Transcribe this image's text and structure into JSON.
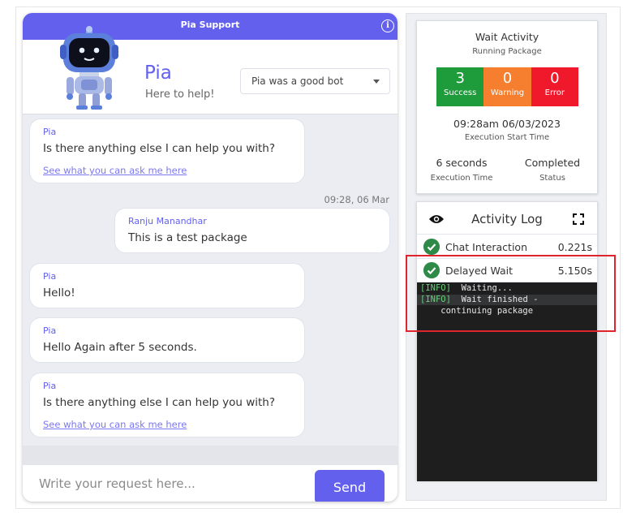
{
  "chat": {
    "title": "Pia Support",
    "info_glyph": "i",
    "bot_name": "Pia",
    "bot_subtitle": "Here to help!",
    "rating_value": "Pia was a good bot",
    "messages": [
      {
        "sender": "Pia",
        "text": "Is there anything else I can help you with?",
        "link": "See what you can ask me here"
      },
      {
        "timestamp": "09:28, 06 Mar"
      },
      {
        "sender": "Ranju Manandhar",
        "text": "This is a test package"
      },
      {
        "sender": "Pia",
        "text": "Hello!"
      },
      {
        "sender": "Pia",
        "text": "Hello Again after 5 seconds."
      },
      {
        "sender": "Pia",
        "text": "Is there anything else I can help you with?",
        "link": "See what you can ask me here"
      }
    ],
    "input_placeholder": "Write your request here...",
    "send_label": "Send",
    "accent_color": "#6360ee"
  },
  "wait_activity": {
    "title": "Wait Activity",
    "subtitle": "Running Package",
    "stats": [
      {
        "value": "3",
        "label": "Success",
        "color": "#1e9b3a"
      },
      {
        "value": "0",
        "label": "Warning",
        "color": "#f57f2f"
      },
      {
        "value": "0",
        "label": "Error",
        "color": "#f0182b"
      }
    ],
    "start_time": "09:28am 06/03/2023",
    "start_time_label": "Execution Start Time",
    "execution_time": "6 seconds",
    "execution_time_label": "Execution Time",
    "status": "Completed",
    "status_label": "Status"
  },
  "activity_log": {
    "title": "Activity Log",
    "items": [
      {
        "name": "Chat Interaction",
        "duration": "0.221s"
      },
      {
        "name": "Delayed Wait",
        "duration": "5.150s"
      }
    ],
    "console": [
      {
        "tag": "[INFO]",
        "text": "  Waiting..."
      },
      {
        "tag": "[INFO]",
        "text": "  Wait finished -"
      },
      {
        "tag": "",
        "text": "    continuing package"
      }
    ]
  }
}
